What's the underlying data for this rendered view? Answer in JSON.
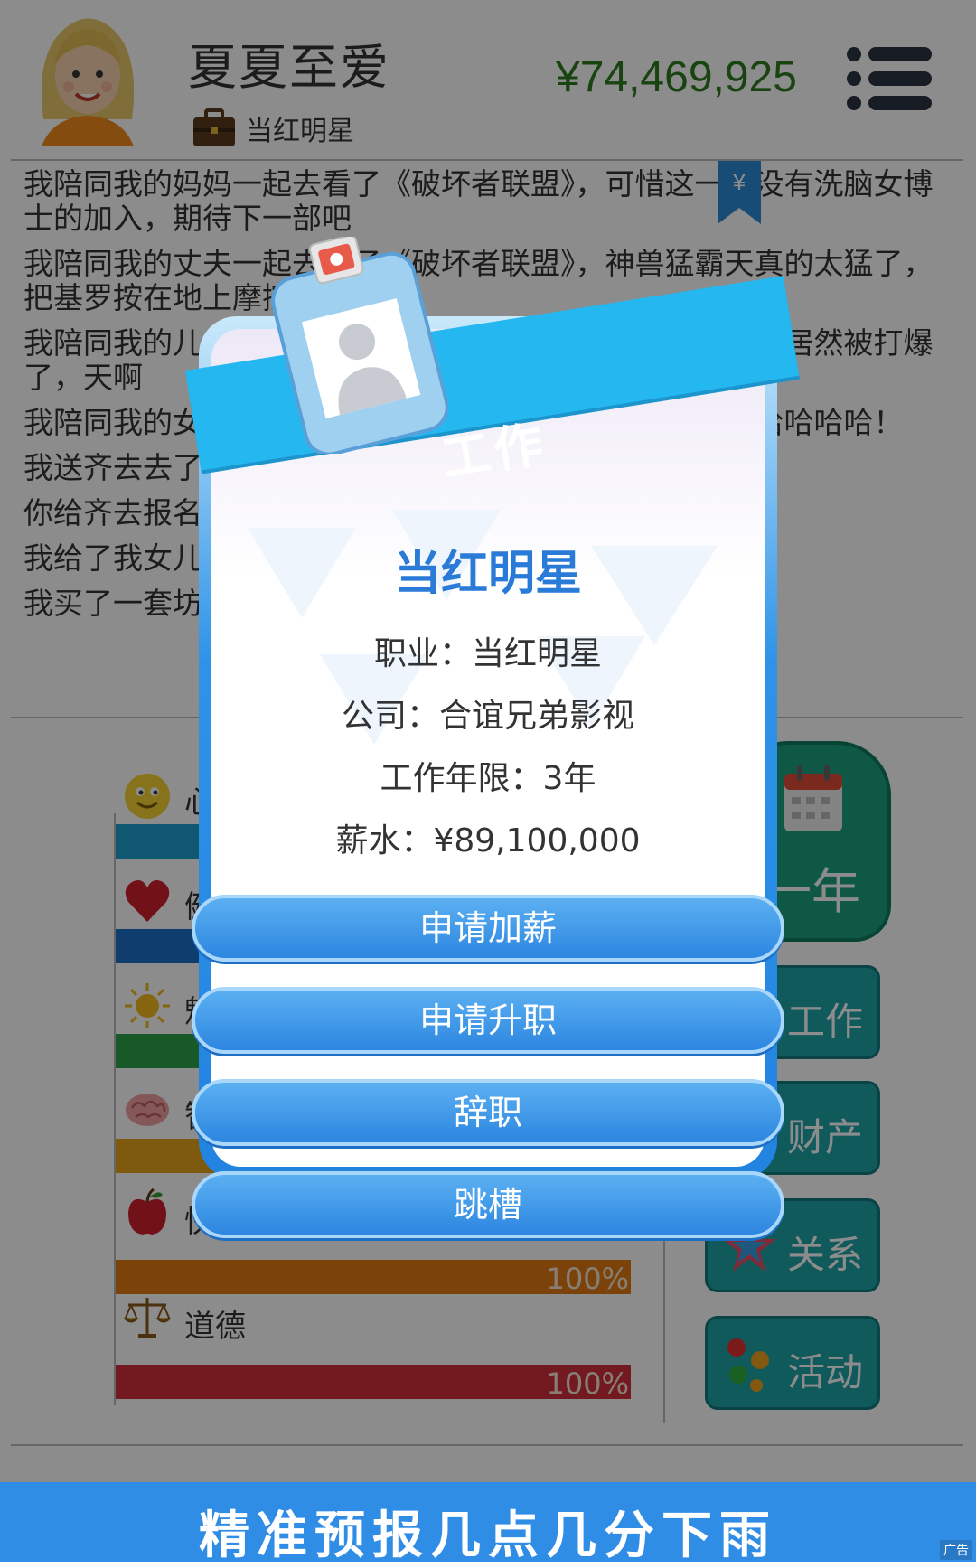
{
  "header": {
    "player_name": "夏夏至爱",
    "job": "当红明星",
    "money": "¥74,469,925",
    "menu_icon": "menu-icon",
    "avatar_icon": "avatar-girl"
  },
  "log": [
    "我陪同我的妈妈一起去看了《破坏者联盟》，可惜这一部没有洗脑女博士的加入，期待下一部吧",
    "我陪同我的丈夫一起去看了《破坏者联盟》，神兽猛霸天真的太猛了，把基罗按在地上摩擦，酷！",
    "我陪同我的儿子一起去看了《破坏者联盟》，那个钢铁男人居然被打爆了，天啊",
    "我陪同我的女儿一起去看了《破坏者联盟》，哈哈哈哈哈哈哈哈哈！",
    "我送齐去去了",
    "你给齐去报名了",
    "我给了我女儿",
    "我买了一套坊"
  ],
  "stats": [
    {
      "name": "心情",
      "icon": "smiley-icon",
      "color": "#1e9fd0",
      "value": ""
    },
    {
      "name": "健康",
      "icon": "heart-icon",
      "color": "#1a6fc9",
      "value": ""
    },
    {
      "name": "魅力",
      "icon": "sun-icon",
      "color": "#2ba24a",
      "value": ""
    },
    {
      "name": "智慧",
      "icon": "brain-icon",
      "color": "#e4a51a",
      "value": ""
    },
    {
      "name": "快乐",
      "icon": "apple-icon",
      "color": "#e07a12",
      "value": "100%"
    },
    {
      "name": "道德",
      "icon": "scales-icon",
      "color": "#d0303b",
      "value": "100%"
    }
  ],
  "actions": {
    "year": "一年",
    "work": "工作",
    "property": "财产",
    "relations": "关系",
    "activity": "活动"
  },
  "modal": {
    "ribbon": "工作",
    "title": "当红明星",
    "occupation": "职业：当红明星",
    "company": "公司：合谊兄弟影视",
    "years": "工作年限：3年",
    "salary": "薪水：¥89,100,000",
    "buttons": [
      "申请加薪",
      "申请升职",
      "辞职",
      "跳槽"
    ]
  },
  "ad": {
    "text": "精准预报几点几分下雨",
    "tag": "广告"
  }
}
